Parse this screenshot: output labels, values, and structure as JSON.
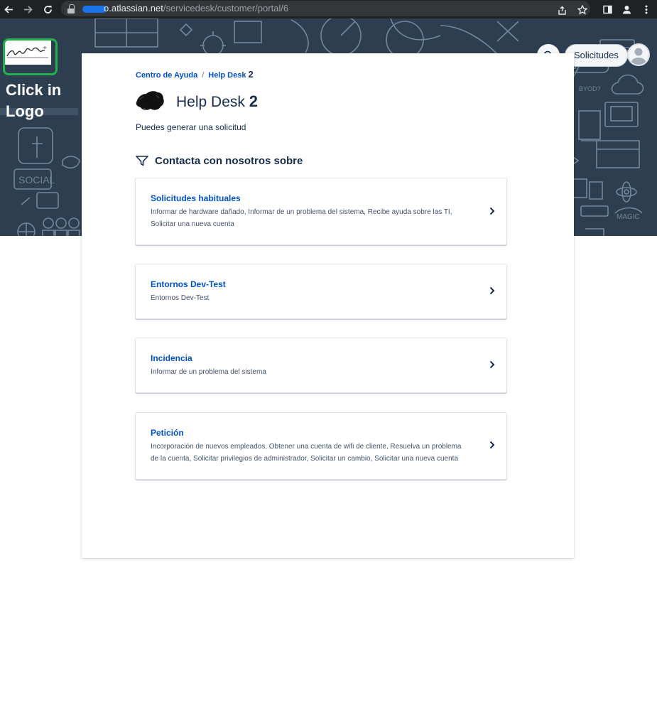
{
  "browser": {
    "url_host": "o.atlassian.net",
    "url_path": "/servicedesk/customer/portal/6",
    "icons": [
      "back-arrow-icon",
      "forward-arrow-icon",
      "reload-icon",
      "lock-icon",
      "share-icon",
      "star-icon",
      "sidebar-icon",
      "profile-icon",
      "menu-dots-icon"
    ]
  },
  "annotation": {
    "line1": "Click in",
    "line2": "Logo"
  },
  "header": {
    "requests_label": "Solicitudes",
    "search_icon": "search-icon",
    "avatar_icon": "user-avatar-icon"
  },
  "breadcrumb": {
    "home": "Centro de Ayuda",
    "separator": "/",
    "current_prefix": "Help Desk",
    "current_suffix": "2"
  },
  "portal": {
    "title_prefix": "Help Desk",
    "title_suffix": "2",
    "description": "Puedes generar una solicitud",
    "contact_heading": "Contacta con nosotros sobre"
  },
  "groups": [
    {
      "name": "Solicitudes habituales",
      "description": "Informar de hardware dañado, Informar de un problema del sistema, Recibe ayuda sobre las TI, Solicitar una nueva cuenta"
    },
    {
      "name": "Entornos Dev-Test",
      "description": "Entornos Dev-Test"
    },
    {
      "name": "Incidencia",
      "description": "Informar de un problema del sistema"
    },
    {
      "name": "Petición",
      "description": "Incorporación de nuevos empleados, Obtener una cuenta de wifi de cliente, Resuelva un problema de la cuenta, Solicitar privilegios de administrador, Solicitar un cambio, Solicitar una nueva cuenta"
    }
  ],
  "colors": {
    "banner": "#2c3e50",
    "link": "#0052cc",
    "highlight": "#22b14c"
  }
}
